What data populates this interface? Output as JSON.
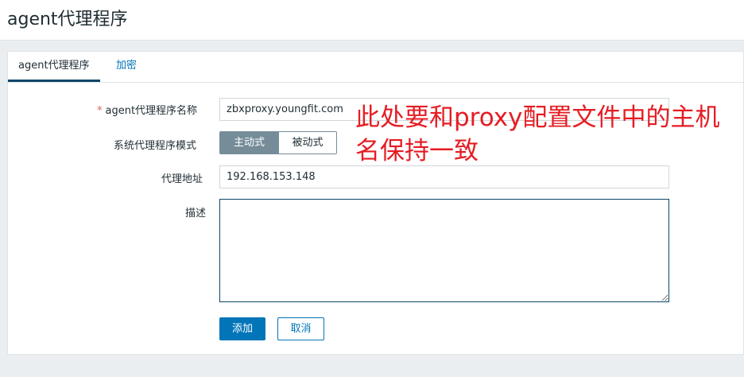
{
  "page": {
    "title": "agent代理程序"
  },
  "tabs": [
    {
      "label": "agent代理程序"
    },
    {
      "label": "加密"
    }
  ],
  "form": {
    "name_required_mark": "*",
    "name_label": "agent代理程序名称",
    "name_value": "zbxproxy.youngfit.com",
    "mode_label": "系统代理程序模式",
    "mode_options": [
      "主动式",
      "被动式"
    ],
    "mode_selected": "主动式",
    "address_label": "代理地址",
    "address_value": "192.168.153.148",
    "description_label": "描述",
    "description_value": ""
  },
  "buttons": {
    "add": "添加",
    "cancel": "取消"
  },
  "annotation": {
    "text": "此处要和proxy配置文件中的主机名保持一致",
    "color": "#e51c23"
  },
  "colors": {
    "primary": "#0275b8",
    "segment_active": "#768d99",
    "tab_underline": "#0a466a"
  }
}
